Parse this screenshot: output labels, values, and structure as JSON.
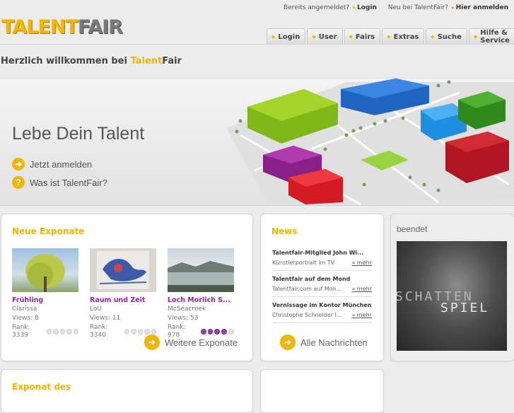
{
  "header": {
    "already": "Bereits angemeldet?",
    "login": "Login",
    "new": "Neu bei TalentFair?",
    "register": "Hier anmelden"
  },
  "logo": {
    "part1": "TALENT",
    "part2": "FAIR"
  },
  "nav": [
    "Login",
    "User",
    "Fairs",
    "Extras",
    "Suche",
    "Hilfe & Service"
  ],
  "welcome": {
    "prefix": "Herzlich willkommen bei ",
    "talent": "Talent",
    "fair": "Fair"
  },
  "banner": {
    "headline": "Lebe Dein Talent",
    "link1": "Jetzt anmelden",
    "link2": "Was ist TalentFair?"
  },
  "exponate": {
    "title": "Neue Exponate",
    "items": [
      {
        "title": "Frühling",
        "artist": "Clarissa",
        "views": "Views: 8",
        "rank": "Rank: 3339",
        "rating": 0
      },
      {
        "title": "Raum und Zeit",
        "artist": "LoU",
        "views": "Views: 11",
        "rank": "Rank: 3340",
        "rating": 0
      },
      {
        "title": "Loch Morlich S...",
        "artist": "McSeacreek",
        "views": "Views: 53",
        "rank": "Rank: 978",
        "rating": 4
      }
    ],
    "more": "Weitere Exponate"
  },
  "news": {
    "title": "News",
    "items": [
      {
        "title": "Talentfair-Mitglied John Wi...",
        "desc": "Künstlerportrait im TV",
        "more": "» mehr"
      },
      {
        "title": "Talentfair auf dem Mond",
        "desc": "Talentfair.com auf Mon...",
        "more": "» mehr"
      },
      {
        "title": "Vernissage im Kontor München",
        "desc": "Christophe Schneider l...",
        "more": "» mehr"
      }
    ],
    "more": "Alle Nachrichten"
  },
  "fair": {
    "status": "beendet",
    "line1": "SCHATTEN",
    "line2": "SPIEL"
  },
  "bottom": {
    "title": "Exponat des"
  },
  "colors": {
    "accent": "#f5b400",
    "purple": "#8a2a9a"
  }
}
